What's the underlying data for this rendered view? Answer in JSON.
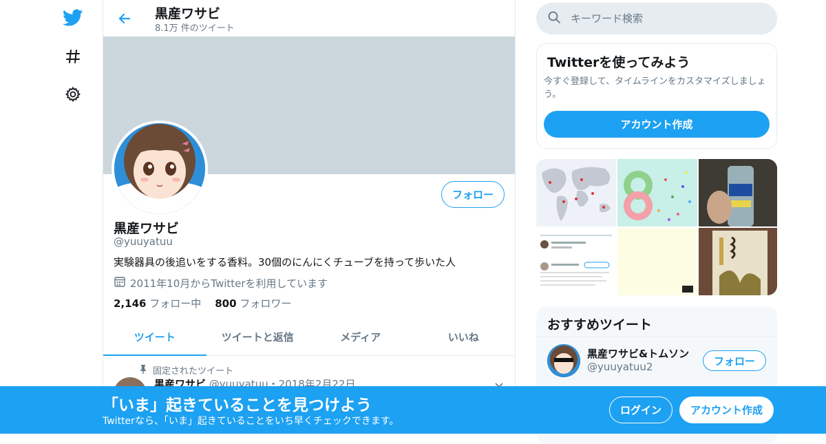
{
  "nav": {
    "icons": [
      "twitter-logo",
      "explore-hashtag-icon",
      "settings-gear-icon"
    ]
  },
  "header": {
    "title": "黒産ワサビ",
    "tweet_count": "8.1万 件のツイート"
  },
  "profile": {
    "follow_label": "フォロー",
    "name": "黒産ワサビ",
    "handle": "@yuuyatuu",
    "bio": "実験器具の後追いをする香料。30個のにんにくチューブを持って歩いた人",
    "joined": "2011年10月からTwitterを利用しています",
    "following_count": "2,146",
    "following_label": "フォロー中",
    "followers_count": "800",
    "followers_label": "フォロワー"
  },
  "tabs": [
    {
      "label": "ツイート",
      "active": true
    },
    {
      "label": "ツイートと返信",
      "active": false
    },
    {
      "label": "メディア",
      "active": false
    },
    {
      "label": "いいね",
      "active": false
    }
  ],
  "pinned_tweet": {
    "pinned_label": "固定されたツイート",
    "author": "黒産ワサビ",
    "handle_date": "@yuuyatuu・2018年2月22日"
  },
  "search": {
    "placeholder": "キーワード検索"
  },
  "signup_card": {
    "title": "Twitterを使ってみよう",
    "description": "今すぐ登録して、タイムラインをカスタマイズしましょう。",
    "button": "アカウント作成"
  },
  "recommended": {
    "title": "おすすめツイート",
    "name": "黒産ワサビ&トムソン",
    "handle": "@yuuyatuu2",
    "follow_label": "フォロー"
  },
  "bottom_bar": {
    "title": "「いま」起きていることを見つけよう",
    "subtitle": "Twitterなら、「いま」起きていることをいち早くチェックできます。",
    "login": "ログイン",
    "signup": "アカウント作成"
  },
  "colors": {
    "accent": "#1da1f2",
    "banner": "#ccd6dd",
    "muted": "#657786"
  }
}
